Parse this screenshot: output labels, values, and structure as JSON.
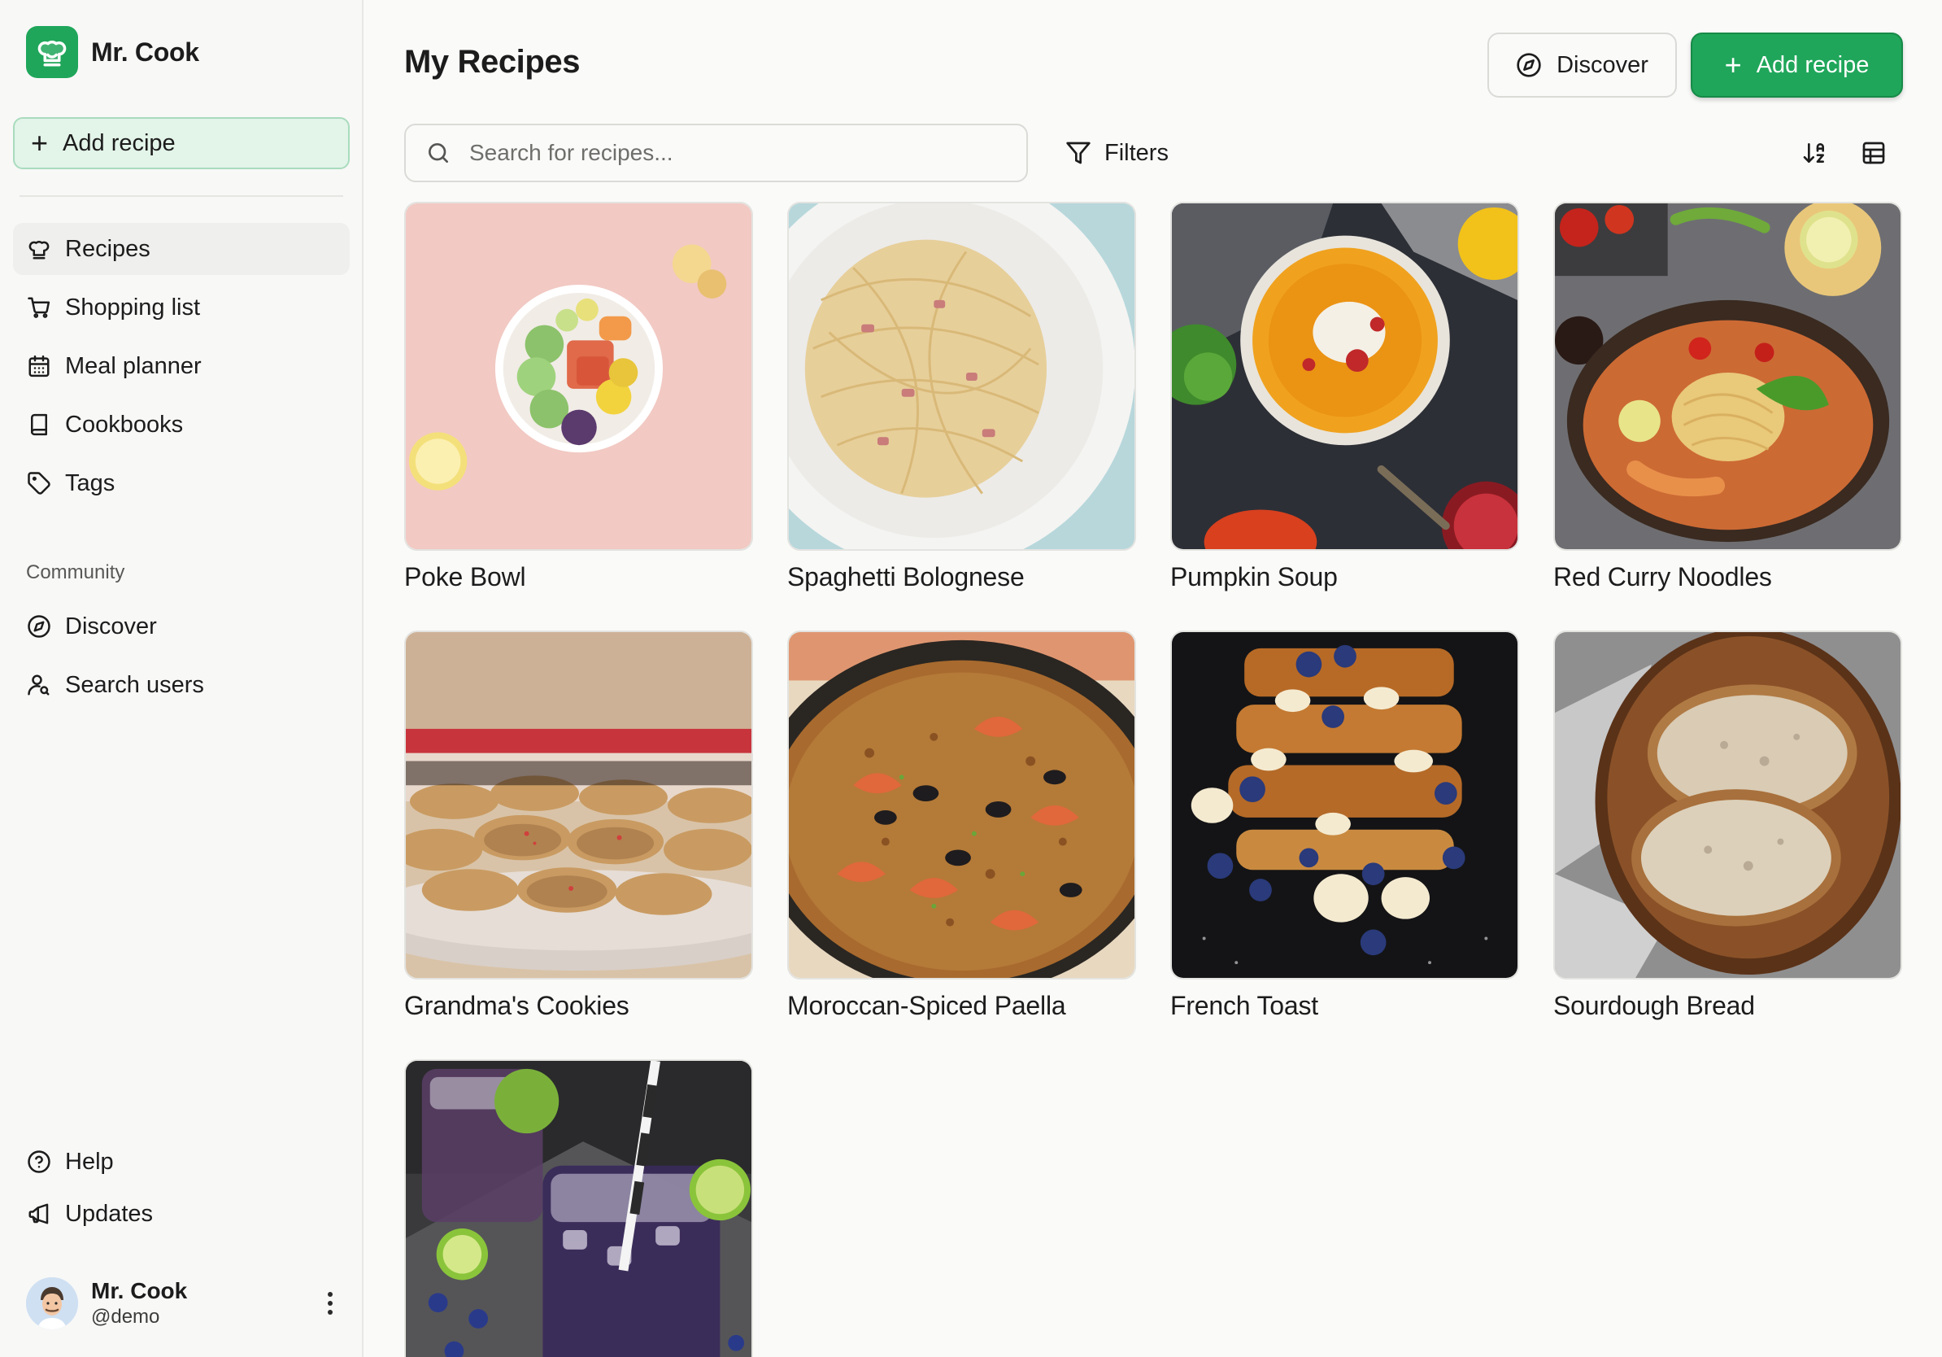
{
  "brand": {
    "name": "Mr. Cook",
    "logo_icon": "chef-hat-icon",
    "accent": "#1fa65a"
  },
  "sidebar": {
    "add_recipe_label": "Add recipe",
    "nav": [
      {
        "label": "Recipes",
        "icon": "chef-hat-icon",
        "active": true
      },
      {
        "label": "Shopping list",
        "icon": "cart-icon"
      },
      {
        "label": "Meal planner",
        "icon": "calendar-icon"
      },
      {
        "label": "Cookbooks",
        "icon": "book-icon"
      },
      {
        "label": "Tags",
        "icon": "tag-icon"
      }
    ],
    "community_label": "Community",
    "community": [
      {
        "label": "Discover",
        "icon": "compass-icon"
      },
      {
        "label": "Search users",
        "icon": "user-search-icon"
      }
    ],
    "footer": [
      {
        "label": "Help",
        "icon": "help-circle-icon"
      },
      {
        "label": "Updates",
        "icon": "megaphone-icon"
      }
    ],
    "profile": {
      "name": "Mr. Cook",
      "handle": "@demo"
    }
  },
  "header": {
    "title": "My Recipes",
    "discover_label": "Discover",
    "add_recipe_label": "Add recipe"
  },
  "toolbar": {
    "search_placeholder": "Search for recipes...",
    "filters_label": "Filters"
  },
  "recipes": [
    {
      "title": "Poke Bowl"
    },
    {
      "title": "Spaghetti Bolognese"
    },
    {
      "title": "Pumpkin Soup"
    },
    {
      "title": "Red Curry Noodles"
    },
    {
      "title": "Grandma's Cookies"
    },
    {
      "title": "Moroccan-Spiced Paella"
    },
    {
      "title": "French Toast"
    },
    {
      "title": "Sourdough Bread"
    },
    {
      "title": ""
    }
  ]
}
